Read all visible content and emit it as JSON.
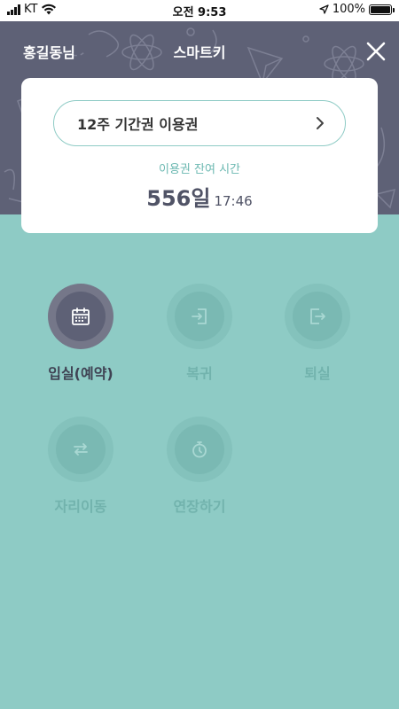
{
  "status_bar": {
    "carrier": "KT",
    "time": "오전 9:53",
    "battery": "100%"
  },
  "header": {
    "user_name": "홍길동님",
    "title": "스마트키"
  },
  "ticket": {
    "pass_name": "12주 기간권 이용권",
    "remaining_label": "이용권 잔여 시간",
    "remaining_days": "556일",
    "remaining_time": "17:46"
  },
  "actions": [
    {
      "label": "입실(예약)",
      "icon": "calendar-icon",
      "state": "active"
    },
    {
      "label": "복귀",
      "icon": "enter-icon",
      "state": "disabled"
    },
    {
      "label": "퇴실",
      "icon": "exit-icon",
      "state": "disabled"
    },
    {
      "label": "자리이동",
      "icon": "swap-icon",
      "state": "disabled"
    },
    {
      "label": "연장하기",
      "icon": "stopwatch-icon",
      "state": "disabled"
    }
  ],
  "colors": {
    "header_bg": "#5E6176",
    "body_bg": "#8ECBC5",
    "accent": "#6BB8B1",
    "card_bg": "#FFFFFF"
  }
}
